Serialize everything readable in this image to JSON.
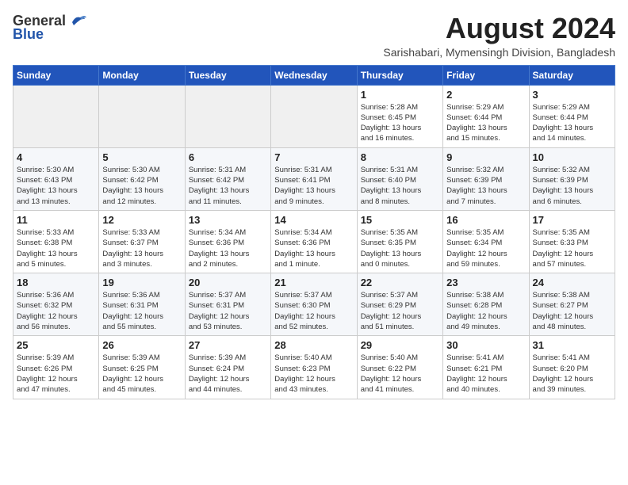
{
  "header": {
    "logo_general": "General",
    "logo_blue": "Blue",
    "month_title": "August 2024",
    "location": "Sarishabari, Mymensingh Division, Bangladesh"
  },
  "weekdays": [
    "Sunday",
    "Monday",
    "Tuesday",
    "Wednesday",
    "Thursday",
    "Friday",
    "Saturday"
  ],
  "weeks": [
    [
      {
        "day": "",
        "info": ""
      },
      {
        "day": "",
        "info": ""
      },
      {
        "day": "",
        "info": ""
      },
      {
        "day": "",
        "info": ""
      },
      {
        "day": "1",
        "info": "Sunrise: 5:28 AM\nSunset: 6:45 PM\nDaylight: 13 hours\nand 16 minutes."
      },
      {
        "day": "2",
        "info": "Sunrise: 5:29 AM\nSunset: 6:44 PM\nDaylight: 13 hours\nand 15 minutes."
      },
      {
        "day": "3",
        "info": "Sunrise: 5:29 AM\nSunset: 6:44 PM\nDaylight: 13 hours\nand 14 minutes."
      }
    ],
    [
      {
        "day": "4",
        "info": "Sunrise: 5:30 AM\nSunset: 6:43 PM\nDaylight: 13 hours\nand 13 minutes."
      },
      {
        "day": "5",
        "info": "Sunrise: 5:30 AM\nSunset: 6:42 PM\nDaylight: 13 hours\nand 12 minutes."
      },
      {
        "day": "6",
        "info": "Sunrise: 5:31 AM\nSunset: 6:42 PM\nDaylight: 13 hours\nand 11 minutes."
      },
      {
        "day": "7",
        "info": "Sunrise: 5:31 AM\nSunset: 6:41 PM\nDaylight: 13 hours\nand 9 minutes."
      },
      {
        "day": "8",
        "info": "Sunrise: 5:31 AM\nSunset: 6:40 PM\nDaylight: 13 hours\nand 8 minutes."
      },
      {
        "day": "9",
        "info": "Sunrise: 5:32 AM\nSunset: 6:39 PM\nDaylight: 13 hours\nand 7 minutes."
      },
      {
        "day": "10",
        "info": "Sunrise: 5:32 AM\nSunset: 6:39 PM\nDaylight: 13 hours\nand 6 minutes."
      }
    ],
    [
      {
        "day": "11",
        "info": "Sunrise: 5:33 AM\nSunset: 6:38 PM\nDaylight: 13 hours\nand 5 minutes."
      },
      {
        "day": "12",
        "info": "Sunrise: 5:33 AM\nSunset: 6:37 PM\nDaylight: 13 hours\nand 3 minutes."
      },
      {
        "day": "13",
        "info": "Sunrise: 5:34 AM\nSunset: 6:36 PM\nDaylight: 13 hours\nand 2 minutes."
      },
      {
        "day": "14",
        "info": "Sunrise: 5:34 AM\nSunset: 6:36 PM\nDaylight: 13 hours\nand 1 minute."
      },
      {
        "day": "15",
        "info": "Sunrise: 5:35 AM\nSunset: 6:35 PM\nDaylight: 13 hours\nand 0 minutes."
      },
      {
        "day": "16",
        "info": "Sunrise: 5:35 AM\nSunset: 6:34 PM\nDaylight: 12 hours\nand 59 minutes."
      },
      {
        "day": "17",
        "info": "Sunrise: 5:35 AM\nSunset: 6:33 PM\nDaylight: 12 hours\nand 57 minutes."
      }
    ],
    [
      {
        "day": "18",
        "info": "Sunrise: 5:36 AM\nSunset: 6:32 PM\nDaylight: 12 hours\nand 56 minutes."
      },
      {
        "day": "19",
        "info": "Sunrise: 5:36 AM\nSunset: 6:31 PM\nDaylight: 12 hours\nand 55 minutes."
      },
      {
        "day": "20",
        "info": "Sunrise: 5:37 AM\nSunset: 6:31 PM\nDaylight: 12 hours\nand 53 minutes."
      },
      {
        "day": "21",
        "info": "Sunrise: 5:37 AM\nSunset: 6:30 PM\nDaylight: 12 hours\nand 52 minutes."
      },
      {
        "day": "22",
        "info": "Sunrise: 5:37 AM\nSunset: 6:29 PM\nDaylight: 12 hours\nand 51 minutes."
      },
      {
        "day": "23",
        "info": "Sunrise: 5:38 AM\nSunset: 6:28 PM\nDaylight: 12 hours\nand 49 minutes."
      },
      {
        "day": "24",
        "info": "Sunrise: 5:38 AM\nSunset: 6:27 PM\nDaylight: 12 hours\nand 48 minutes."
      }
    ],
    [
      {
        "day": "25",
        "info": "Sunrise: 5:39 AM\nSunset: 6:26 PM\nDaylight: 12 hours\nand 47 minutes."
      },
      {
        "day": "26",
        "info": "Sunrise: 5:39 AM\nSunset: 6:25 PM\nDaylight: 12 hours\nand 45 minutes."
      },
      {
        "day": "27",
        "info": "Sunrise: 5:39 AM\nSunset: 6:24 PM\nDaylight: 12 hours\nand 44 minutes."
      },
      {
        "day": "28",
        "info": "Sunrise: 5:40 AM\nSunset: 6:23 PM\nDaylight: 12 hours\nand 43 minutes."
      },
      {
        "day": "29",
        "info": "Sunrise: 5:40 AM\nSunset: 6:22 PM\nDaylight: 12 hours\nand 41 minutes."
      },
      {
        "day": "30",
        "info": "Sunrise: 5:41 AM\nSunset: 6:21 PM\nDaylight: 12 hours\nand 40 minutes."
      },
      {
        "day": "31",
        "info": "Sunrise: 5:41 AM\nSunset: 6:20 PM\nDaylight: 12 hours\nand 39 minutes."
      }
    ]
  ]
}
